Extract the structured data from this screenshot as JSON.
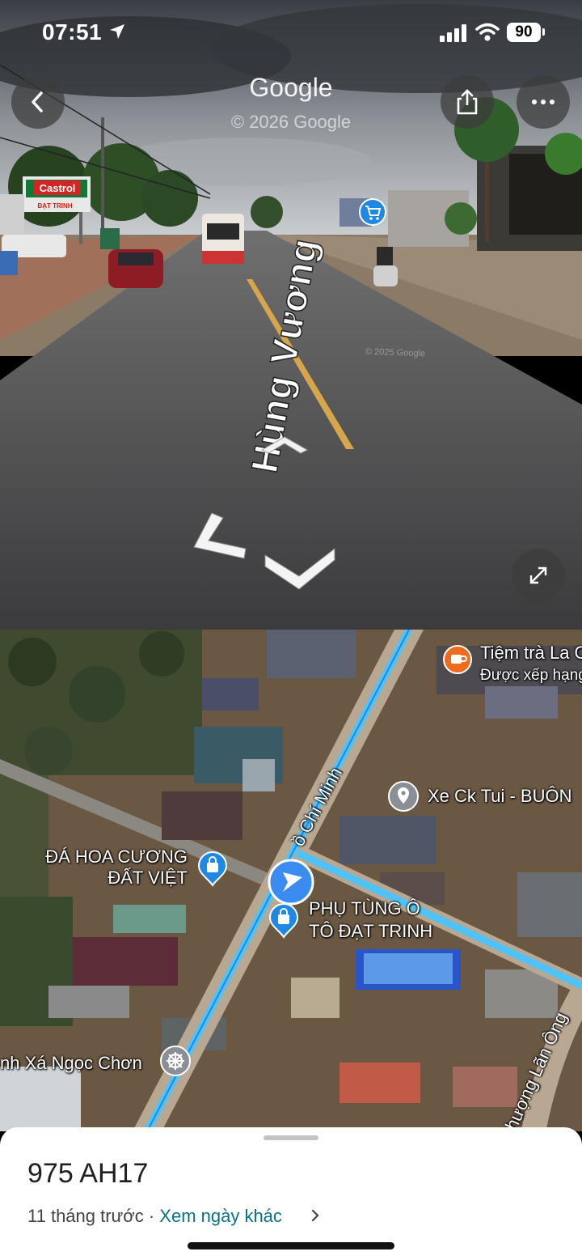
{
  "status_bar": {
    "time": "07:51",
    "battery": "90"
  },
  "street_view": {
    "brand": "Google",
    "copyright": "© 2026 Google",
    "road_name": "Hùng Vương",
    "watermark": "© 2025 Google",
    "store_sign": "Castrol",
    "store_sign_sub": "ĐẠT TRINH"
  },
  "map": {
    "street_main": "ồ Chí Minh",
    "street_side": "hượng Lãn Ông",
    "places": [
      {
        "name": "Tiệm trà La C",
        "subtitle": "Được xếp hạng",
        "icon": "cafe-icon"
      },
      {
        "name": "Xe Ck Tui - BUÔN",
        "icon": "place-pin-icon"
      },
      {
        "name_line1": "ĐÁ HOA CƯƠNG",
        "name_line2": "ĐẤT VIỆT",
        "icon": "shopping-bag-icon"
      },
      {
        "name_line1": "PHỤ TÙNG Ô",
        "name_line2": "TÔ ĐẠT TRINH",
        "icon": "shopping-bag-icon"
      },
      {
        "name": "nh Xá Ngọc Chơn",
        "icon": "dharma-wheel-icon"
      }
    ]
  },
  "sheet": {
    "title": "975 AH17",
    "date_text": "11 tháng trước",
    "separator": " · ",
    "other_dates_link": "Xem ngày khác"
  },
  "colors": {
    "accent_teal": "#0b7285",
    "map_blue": "#3b8cf0",
    "road_highlight": "#4fc3f7"
  }
}
